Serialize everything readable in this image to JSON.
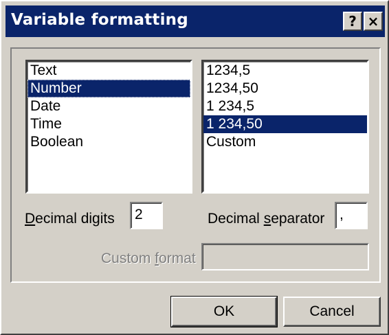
{
  "window": {
    "title": "Variable formatting",
    "help_glyph": "?",
    "close_glyph": "×"
  },
  "types_list": {
    "items": [
      {
        "label": "Text",
        "selected": false
      },
      {
        "label": "Number",
        "selected": true
      },
      {
        "label": "Date",
        "selected": false
      },
      {
        "label": "Time",
        "selected": false
      },
      {
        "label": "Boolean",
        "selected": false
      }
    ]
  },
  "formats_list": {
    "items": [
      {
        "label": "1234,5",
        "selected": false
      },
      {
        "label": "1234,50",
        "selected": false
      },
      {
        "label": "1 234,5",
        "selected": false
      },
      {
        "label": "1 234,50",
        "selected": true
      },
      {
        "label": "Custom",
        "selected": false
      }
    ]
  },
  "decimal_digits": {
    "label_mnemonic": "D",
    "label_rest": "ecimal digits",
    "value": "2"
  },
  "decimal_separator": {
    "label_pre": "Decimal ",
    "label_mnemonic": "s",
    "label_post": "eparator",
    "value": ","
  },
  "custom_format": {
    "label_pre": "Custom ",
    "label_mnemonic": "f",
    "label_post": "ormat",
    "value": "",
    "enabled": false
  },
  "buttons": {
    "ok": "OK",
    "cancel": "Cancel"
  },
  "colors": {
    "face": "#d4d0c8",
    "title_bar": "#0a246a",
    "selection": "#0a246a"
  }
}
